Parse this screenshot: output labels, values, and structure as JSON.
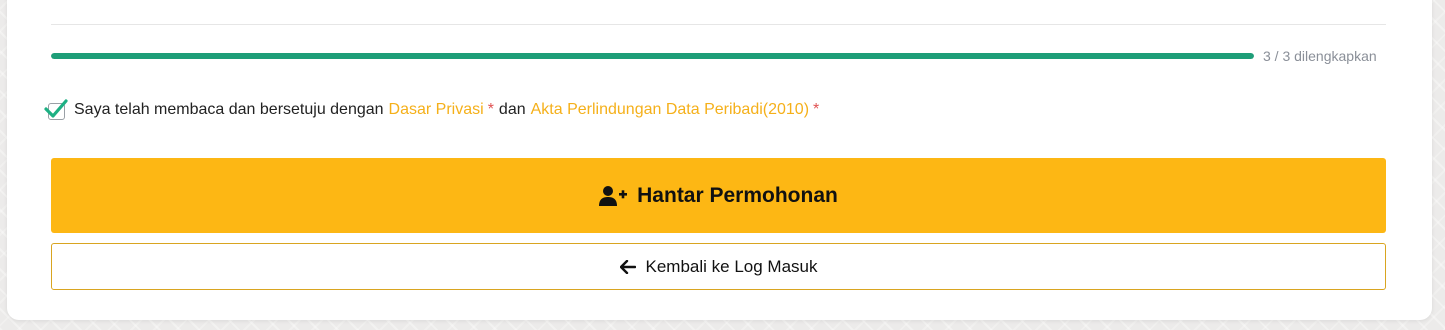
{
  "progress": {
    "text": "3 / 3 dilengkapkan",
    "completed": 3,
    "total": 3,
    "fill_color": "#1e9e78"
  },
  "consent": {
    "checked": true,
    "prefix": "Saya telah membaca dan bersetuju dengan",
    "privacy_link": "Dasar Privasi",
    "required_mark_1": "*",
    "conjunction": "dan",
    "data_act_link": "Akta Perlindungan Data Peribadi(2010)",
    "required_mark_2": "*"
  },
  "actions": {
    "submit_label": "Hantar Permohonan",
    "submit_icon": "user-plus-icon",
    "back_label": "Kembali ke Log Masuk",
    "back_icon": "arrow-left-icon"
  },
  "colors": {
    "accent": "#fdb714",
    "link": "#f5b01a",
    "required": "#e05252",
    "check": "#1db083"
  }
}
